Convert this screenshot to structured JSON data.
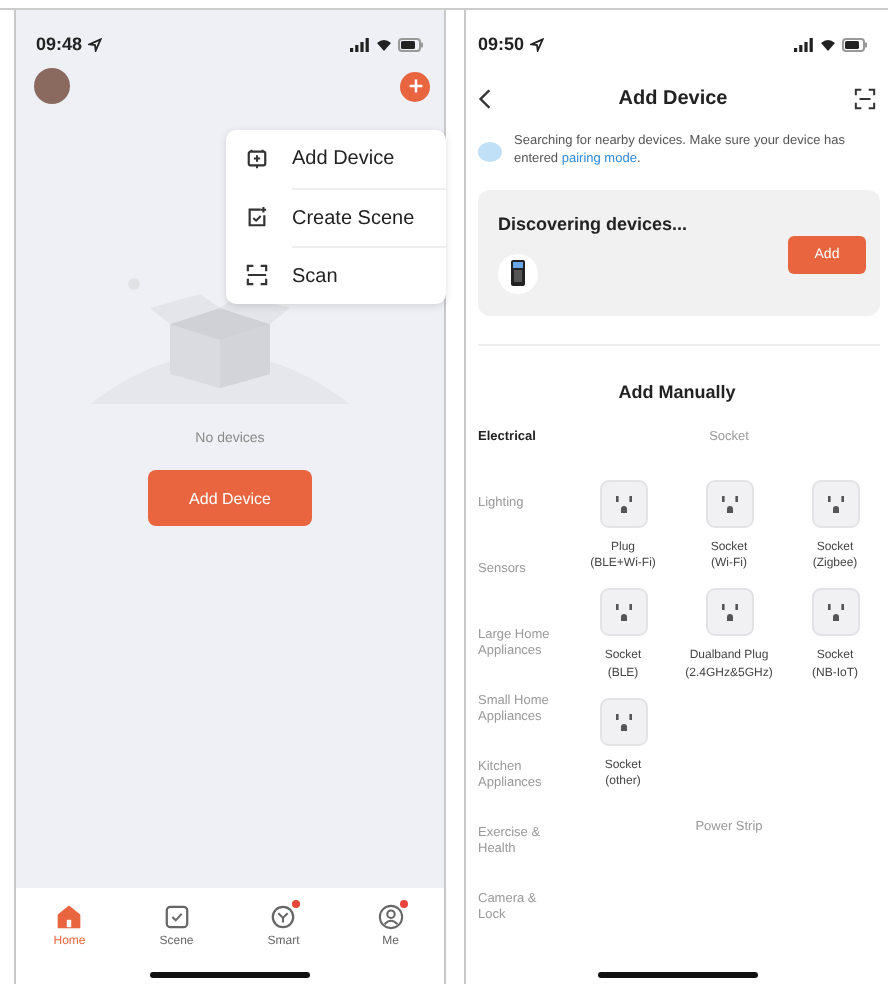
{
  "home_screen": {
    "status_bar": {
      "time": "09:48"
    },
    "menu": [
      {
        "kind": "add",
        "label": "Add Device"
      },
      {
        "kind": "scene",
        "label": "Create Scene"
      },
      {
        "kind": "scan",
        "label": "Scan"
      }
    ],
    "empty_text": "No devices",
    "add_button": "Add Device",
    "tabs": [
      {
        "kind": "home",
        "label": "Home",
        "selected": true,
        "badge": false
      },
      {
        "kind": "scene",
        "label": "Scene",
        "selected": false,
        "badge": false
      },
      {
        "kind": "smart",
        "label": "Smart",
        "selected": false,
        "badge": true
      },
      {
        "kind": "me",
        "label": "Me",
        "selected": false,
        "badge": true
      }
    ]
  },
  "add_device_screen": {
    "status_bar": {
      "time": "09:50"
    },
    "title": "Add Device",
    "notice": "Searching for nearby devices. Make sure your device has entered ",
    "notice_link": "pairing mode",
    "notice_end": ".",
    "discovering": {
      "title": "Discovering devices...",
      "button": "Add"
    },
    "manual_title": "Add Manually",
    "categories": [
      {
        "label": "Electrical",
        "selected": true
      },
      {
        "label": "Lighting",
        "selected": false
      },
      {
        "label": "Sensors",
        "selected": false
      },
      {
        "label": "Large Home Appliances",
        "selected": false
      },
      {
        "label": "Small Home Appliances",
        "selected": false
      },
      {
        "label": "Kitchen Appliances",
        "selected": false
      },
      {
        "label": "Exercise & Health",
        "selected": false
      },
      {
        "label": "Camera & Lock",
        "selected": false
      }
    ],
    "sections": [
      {
        "title": "Socket",
        "items": [
          {
            "name": "Plug",
            "variant": "(BLE+Wi-Fi)"
          },
          {
            "name": "Socket",
            "variant": "(Wi-Fi)"
          },
          {
            "name": "Socket",
            "variant": "(Zigbee)"
          },
          {
            "name": "Socket",
            "variant": "(BLE)"
          },
          {
            "name": "Dualband Plug",
            "variant": "(2.4GHz&5GHz)"
          },
          {
            "name": "Socket",
            "variant": "(NB-IoT)"
          },
          {
            "name": "Socket",
            "variant": "(other)"
          }
        ]
      },
      {
        "title": "Power Strip"
      }
    ]
  }
}
